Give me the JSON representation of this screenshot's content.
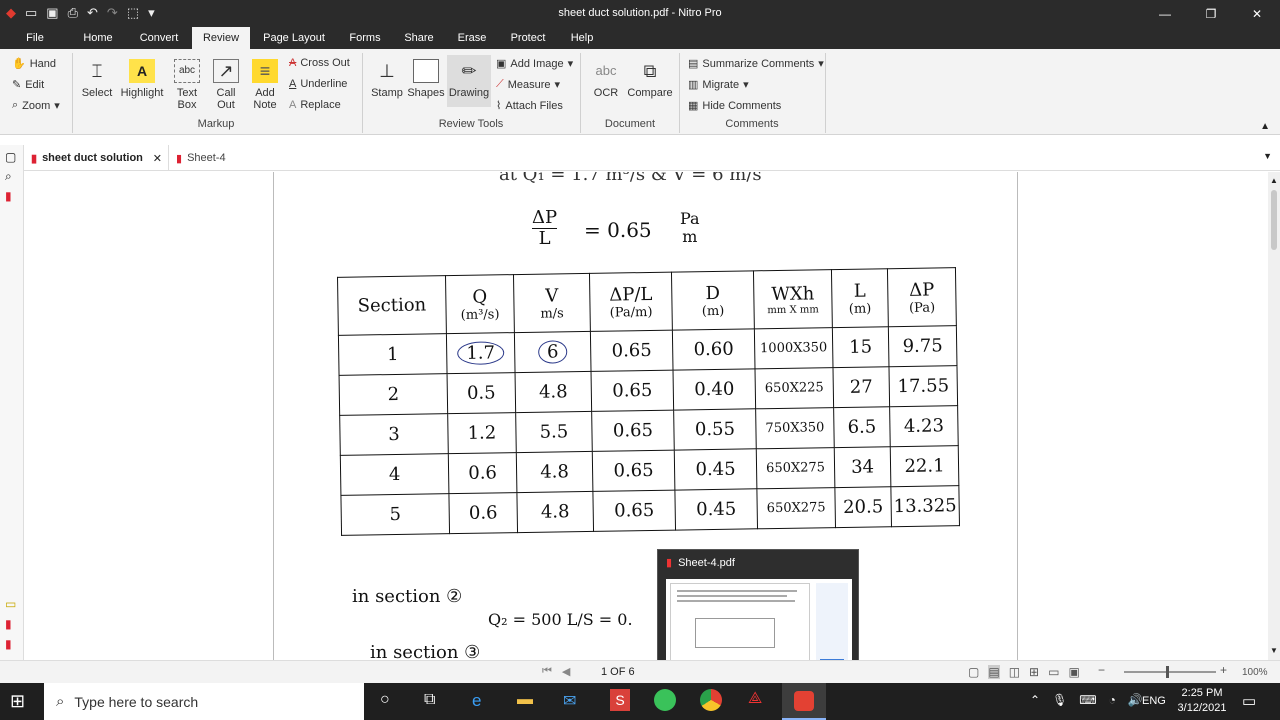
{
  "window": {
    "title": "sheet duct solution.pdf - Nitro Pro"
  },
  "menu_tabs": [
    "File",
    "Home",
    "Convert",
    "Review",
    "Page Layout",
    "Forms",
    "Share",
    "Erase",
    "Protect",
    "Help"
  ],
  "active_tab": "Review",
  "ribbon": {
    "nav": [
      "Hand",
      "Edit",
      "Zoom"
    ],
    "markup": [
      "Select",
      "Highlight",
      "Text Box",
      "Call Out",
      "Add Note"
    ],
    "markup_small": [
      "Cross Out",
      "Underline",
      "Replace"
    ],
    "markup_group": "Markup",
    "review_tools": [
      "Stamp",
      "Shapes",
      "Drawing"
    ],
    "review_small": [
      "Add Image",
      "Measure",
      "Attach Files"
    ],
    "review_group": "Review Tools",
    "document": [
      "OCR",
      "Compare"
    ],
    "document_group": "Document",
    "comments_small": [
      "Summarize Comments",
      "Migrate",
      "Hide Comments"
    ],
    "comments_group": "Comments"
  },
  "doc_tabs": [
    {
      "label": "sheet duct solution",
      "active": true
    },
    {
      "label": "Sheet-4",
      "active": false
    }
  ],
  "content": {
    "top_line": "at Q₁ = 1.7 m³/s  &  V = 6 m/s",
    "formula_lhs_num": "ΔP",
    "formula_lhs_den": "L",
    "formula_rhs": "= 0.65",
    "formula_unit_num": "Pa",
    "formula_unit_den": "m",
    "table": {
      "headers": [
        {
          "main": "Section",
          "sub": ""
        },
        {
          "main": "Q",
          "sub": "(m³/s)"
        },
        {
          "main": "V",
          "sub": "m/s"
        },
        {
          "main": "ΔP/L",
          "sub": "(Pa/m)"
        },
        {
          "main": "D",
          "sub": "(m)"
        },
        {
          "main": "WXh",
          "sub": "mm X mm"
        },
        {
          "main": "L",
          "sub": "(m)"
        },
        {
          "main": "ΔP",
          "sub": "(Pa)"
        }
      ],
      "rows": [
        [
          "1",
          "1.7",
          "6",
          "0.65",
          "0.60",
          "1000X350",
          "15",
          "9.75"
        ],
        [
          "2",
          "0.5",
          "4.8",
          "0.65",
          "0.40",
          "650X225",
          "27",
          "17.55"
        ],
        [
          "3",
          "1.2",
          "5.5",
          "0.65",
          "0.55",
          "750X350",
          "6.5",
          "4.23"
        ],
        [
          "4",
          "0.6",
          "4.8",
          "0.65",
          "0.45",
          "650X275",
          "34",
          "22.1"
        ],
        [
          "5",
          "0.6",
          "4.8",
          "0.65",
          "0.45",
          "650X275",
          "20.5",
          "13.325"
        ]
      ]
    },
    "note1": "in section ②",
    "note2": "Q₂ = 500 L/S = 0.",
    "note3": "in section ③"
  },
  "status": {
    "page": "1 OF 6",
    "zoom": "100%"
  },
  "thumbnail": {
    "title": "Sheet-4.pdf"
  },
  "taskbar": {
    "search_placeholder": "Type here to search",
    "time": "2:25 PM",
    "date": "3/12/2021",
    "lang": "ENG"
  }
}
